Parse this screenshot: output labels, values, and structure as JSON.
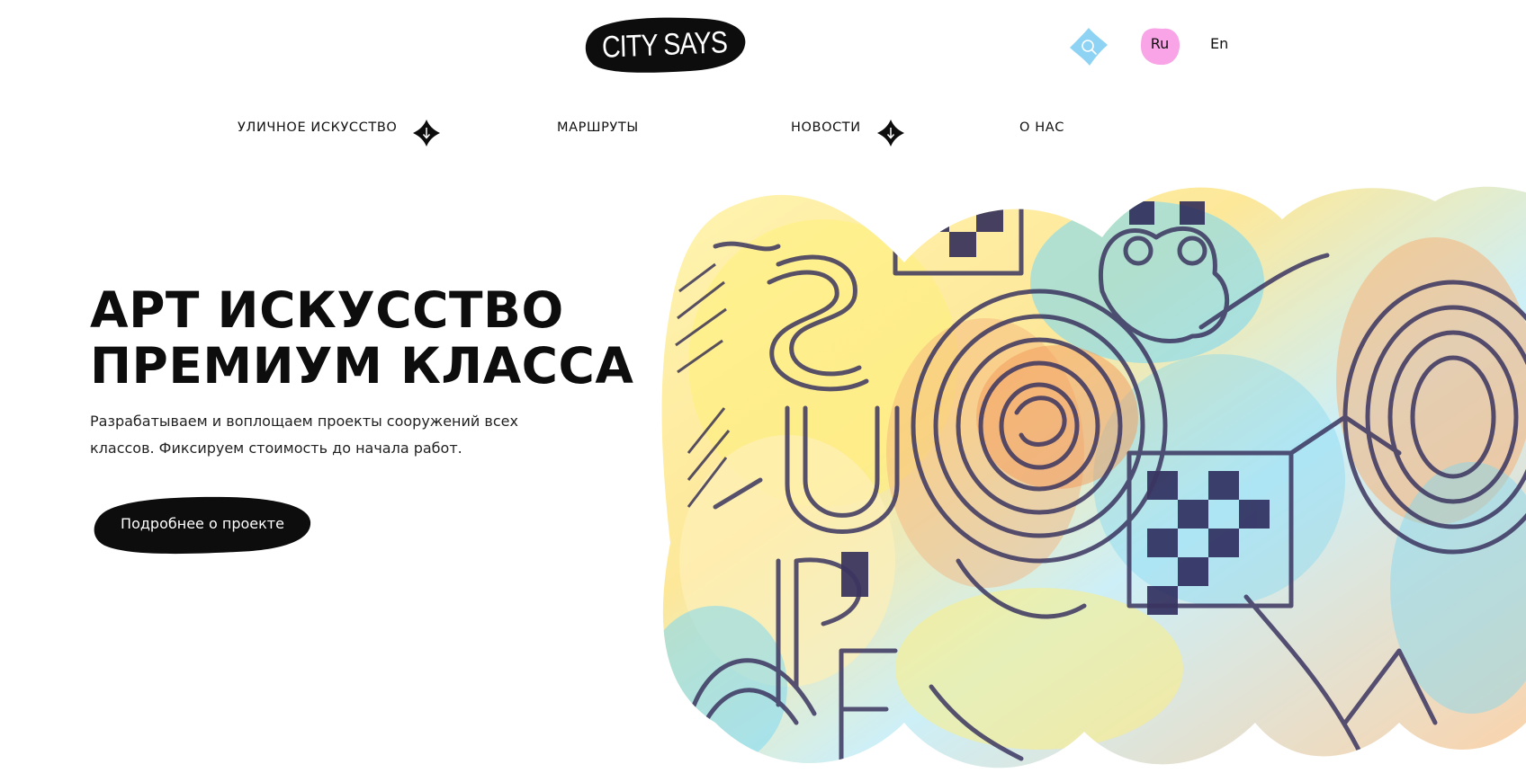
{
  "header": {
    "logo_text": "CITY SAYS",
    "search_icon": "search-icon",
    "languages": {
      "active": "Ru",
      "other": "En"
    }
  },
  "nav": {
    "items": [
      {
        "label": "УЛИЧНОЕ ИСКУССТВО",
        "has_dropdown": true,
        "icon": "arrow-down-icon"
      },
      {
        "label": "МАРШРУТЫ",
        "has_dropdown": false
      },
      {
        "label": "НОВОСТИ",
        "has_dropdown": true,
        "icon": "arrow-down-icon"
      },
      {
        "label": "О НАС",
        "has_dropdown": false
      }
    ]
  },
  "hero": {
    "title_lines": [
      "АРТ ИСКУССТВО",
      "ПРЕМИУМ КЛАССА"
    ],
    "description_lines": [
      "Разрабатываем и воплощаем проекты сооружений всех",
      "классов. Фиксируем стоимость до начала работ."
    ],
    "cta_label": "Подробнее о проекте",
    "art_text": "SUPER"
  },
  "colors": {
    "ink": "#0d0d0d",
    "search_blob": "#8fd3f4",
    "ru_blob": "#f9a4e6",
    "art_yellow": "#fff07a",
    "art_blue": "#7fd8f2",
    "art_orange": "#f5b27a",
    "art_line": "#3b3560"
  }
}
